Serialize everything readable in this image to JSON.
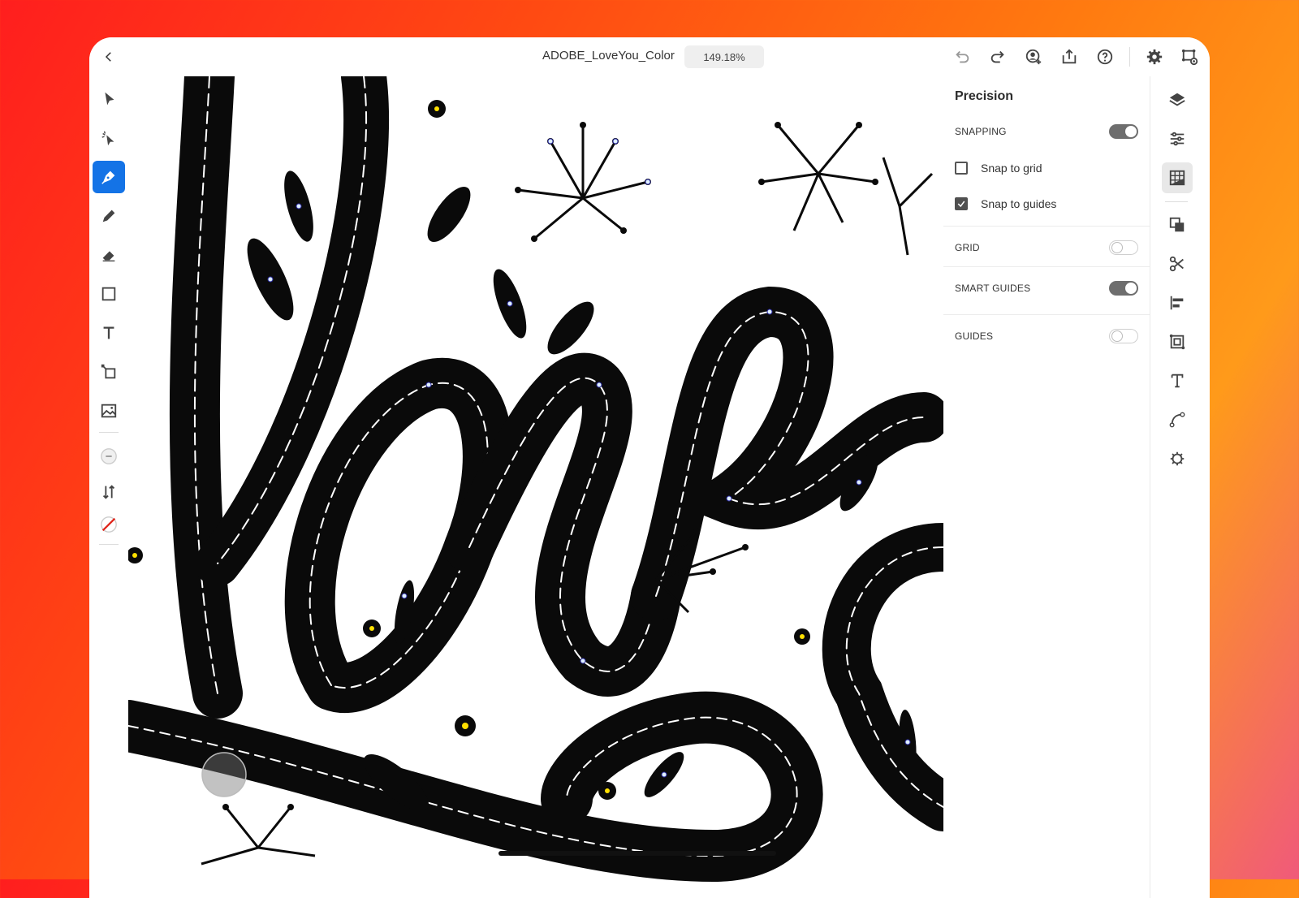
{
  "topbar": {
    "back_icon": "chevron-left-icon",
    "document_title": "ADOBE_LoveYou_Color",
    "zoom_level": "149.18%",
    "icons": [
      "undo-icon",
      "redo-icon",
      "invite-user-icon",
      "share-icon",
      "help-icon",
      "settings-icon",
      "cloud-preview-icon"
    ]
  },
  "left_toolbar": {
    "tools": [
      "selection-icon",
      "direct-selection-icon",
      "pen-icon",
      "pencil-icon",
      "eraser-icon",
      "rectangle-icon",
      "type-icon",
      "transform-icon",
      "place-image-icon",
      "stroke-color-icon",
      "swap-icon",
      "fill-none-icon"
    ],
    "active_tool": "pen-icon"
  },
  "precision_panel": {
    "title": "Precision",
    "snapping_label": "SNAPPING",
    "snapping_on": true,
    "snap_to_grid_label": "Snap to grid",
    "snap_to_grid_checked": false,
    "snap_to_guides_label": "Snap to guides",
    "snap_to_guides_checked": true,
    "grid_label": "GRID",
    "grid_on": false,
    "smart_guides_label": "SMART GUIDES",
    "smart_guides_on": true,
    "guides_label": "GUIDES",
    "guides_on": false
  },
  "right_rail": {
    "tools": [
      "layers-icon",
      "properties-icon",
      "precision-icon",
      "pathfinder-icon",
      "scissors-icon",
      "align-icon",
      "repeat-grid-icon",
      "text-icon",
      "path-icon",
      "plugin-icon"
    ],
    "active_tool": "precision-icon"
  },
  "colors": {
    "accent": "#1473e6",
    "toggle_on": "#6e6e6e",
    "artwork": "#0a0a0a",
    "anchor_points": "#2a2aa0",
    "flower_center": "#ffe000"
  }
}
